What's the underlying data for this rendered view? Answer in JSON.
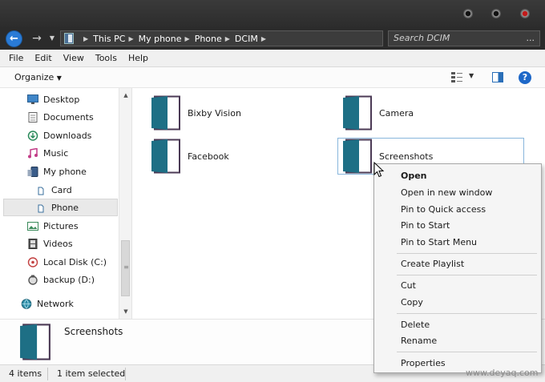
{
  "address": {
    "crumbs": [
      "This PC",
      "My phone",
      "Phone",
      "DCIM"
    ],
    "search_placeholder": "Search DCIM",
    "search_more": "..."
  },
  "menu": [
    "File",
    "Edit",
    "View",
    "Tools",
    "Help"
  ],
  "toolbar": {
    "organize_label": "Organize",
    "help_label": "?"
  },
  "nav": {
    "items": [
      {
        "label": "Desktop",
        "icon": "desktop-icon"
      },
      {
        "label": "Documents",
        "icon": "documents-icon"
      },
      {
        "label": "Downloads",
        "icon": "downloads-icon"
      },
      {
        "label": "Music",
        "icon": "music-icon"
      },
      {
        "label": "My phone",
        "icon": "phone-icon"
      },
      {
        "label": "Card",
        "icon": "card-icon"
      },
      {
        "label": "Phone",
        "icon": "phone-storage-icon",
        "selected": true
      },
      {
        "label": "Pictures",
        "icon": "pictures-icon"
      },
      {
        "label": "Videos",
        "icon": "videos-icon"
      },
      {
        "label": "Local Disk (C:)",
        "icon": "local-disk-icon"
      },
      {
        "label": "backup (D:)",
        "icon": "backup-drive-icon"
      },
      {
        "label": "Network",
        "icon": "network-icon"
      }
    ]
  },
  "folders": [
    {
      "label": "Bixby Vision"
    },
    {
      "label": "Camera"
    },
    {
      "label": "Facebook"
    },
    {
      "label": "Screenshots",
      "selected": true
    }
  ],
  "details": {
    "title": "Screenshots"
  },
  "status": {
    "count": "4 items",
    "selected": "1 item selected"
  },
  "context_menu": {
    "items": [
      "Open",
      "Open in new window",
      "Pin to Quick access",
      "Pin to Start",
      "Pin to Start Menu",
      "Create Playlist",
      "Cut",
      "Copy",
      "Delete",
      "Rename",
      "Properties"
    ]
  },
  "watermark": "www.deyaq.com",
  "colors": {
    "folder_teal": "#1e6f85",
    "folder_frame": "#4b3a55",
    "accent_blue": "#2a7bd6"
  }
}
